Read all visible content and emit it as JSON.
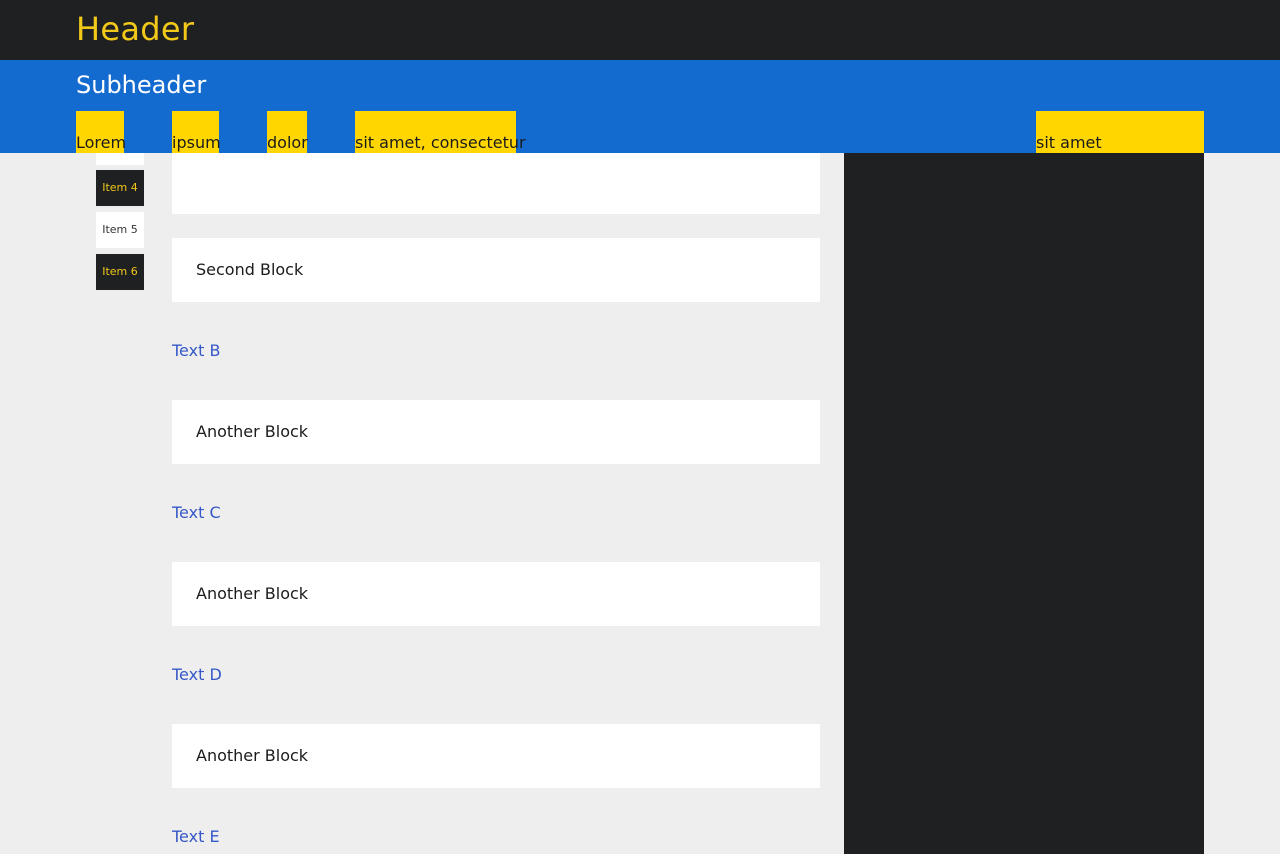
{
  "header": {
    "title": "Header"
  },
  "subheader": {
    "title": "Subheader",
    "nav": [
      "Lorem",
      "ipsum",
      "dolor",
      "sit amet, consectetur",
      "sit amet"
    ]
  },
  "sidebar": {
    "items": [
      "Item 4",
      "Item 5",
      "Item 6"
    ]
  },
  "main": {
    "blocks": [
      "Second Block",
      "Another Block",
      "Another Block",
      "Another Block"
    ],
    "texts": [
      "Text B",
      "Text C",
      "Text D",
      "Text E"
    ]
  },
  "colors": {
    "header_bg": "#1f2022",
    "header_text": "#f2c919",
    "subheader_bg": "#146bcf",
    "nav_bg": "#ffd600",
    "page_bg": "#eeeeee",
    "link_text": "#3658c8",
    "panel_bg": "#1f2022"
  }
}
